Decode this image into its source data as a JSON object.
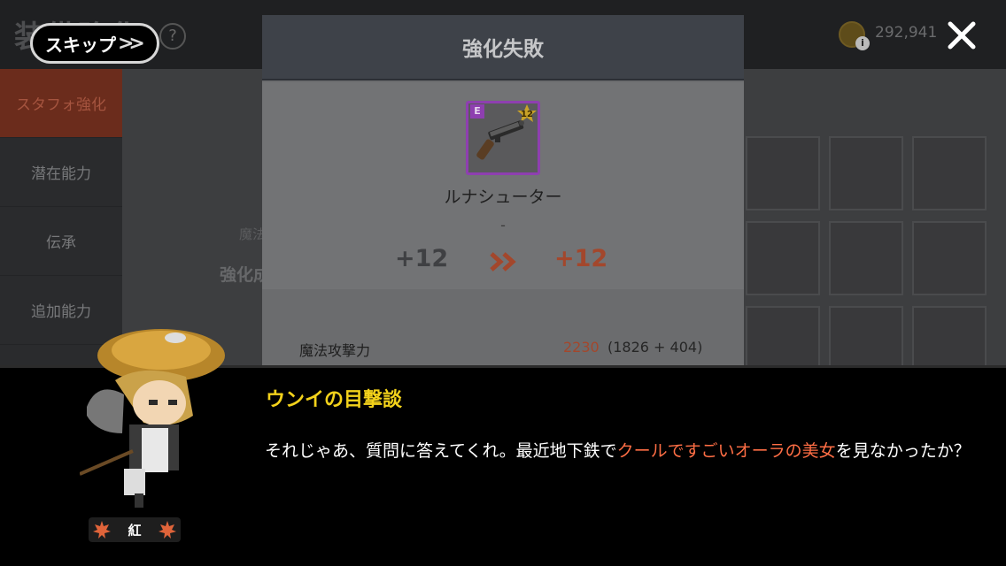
{
  "background": {
    "title": "装備強化",
    "help": "?",
    "sidebar": [
      "スタフォ強化",
      "潜在能力",
      "伝承",
      "追加能力"
    ],
    "behind_labels": [
      "魔法",
      "強化成"
    ],
    "gold": "292,941",
    "info_mark": "i"
  },
  "skip": {
    "label": "スキップ",
    "icon": ">>"
  },
  "close_icon": "close-icon",
  "modal": {
    "title": "強化失敗",
    "item": {
      "grade": "E",
      "level_badge": "12",
      "name": "ルナシューター",
      "sub": "-",
      "from": "+12",
      "to": "+12"
    },
    "stat": {
      "label": "魔法攻撃力",
      "value": "2230",
      "detail": "(1826 + 404)"
    }
  },
  "dialogue": {
    "speaker": "ウンイの目撃談",
    "line_a": "それじゃあ、質問に答えてくれ。最近地下鉄で",
    "line_highlight": "クールですごいオーラの美女",
    "line_b": "を見なかったか？",
    "character_name": "紅"
  },
  "colors": {
    "accent_orange": "#ff6e45",
    "speaker_yellow": "#f3d21b",
    "epic_purple": "#8e3fb0",
    "fail_red": "#a3472c"
  }
}
